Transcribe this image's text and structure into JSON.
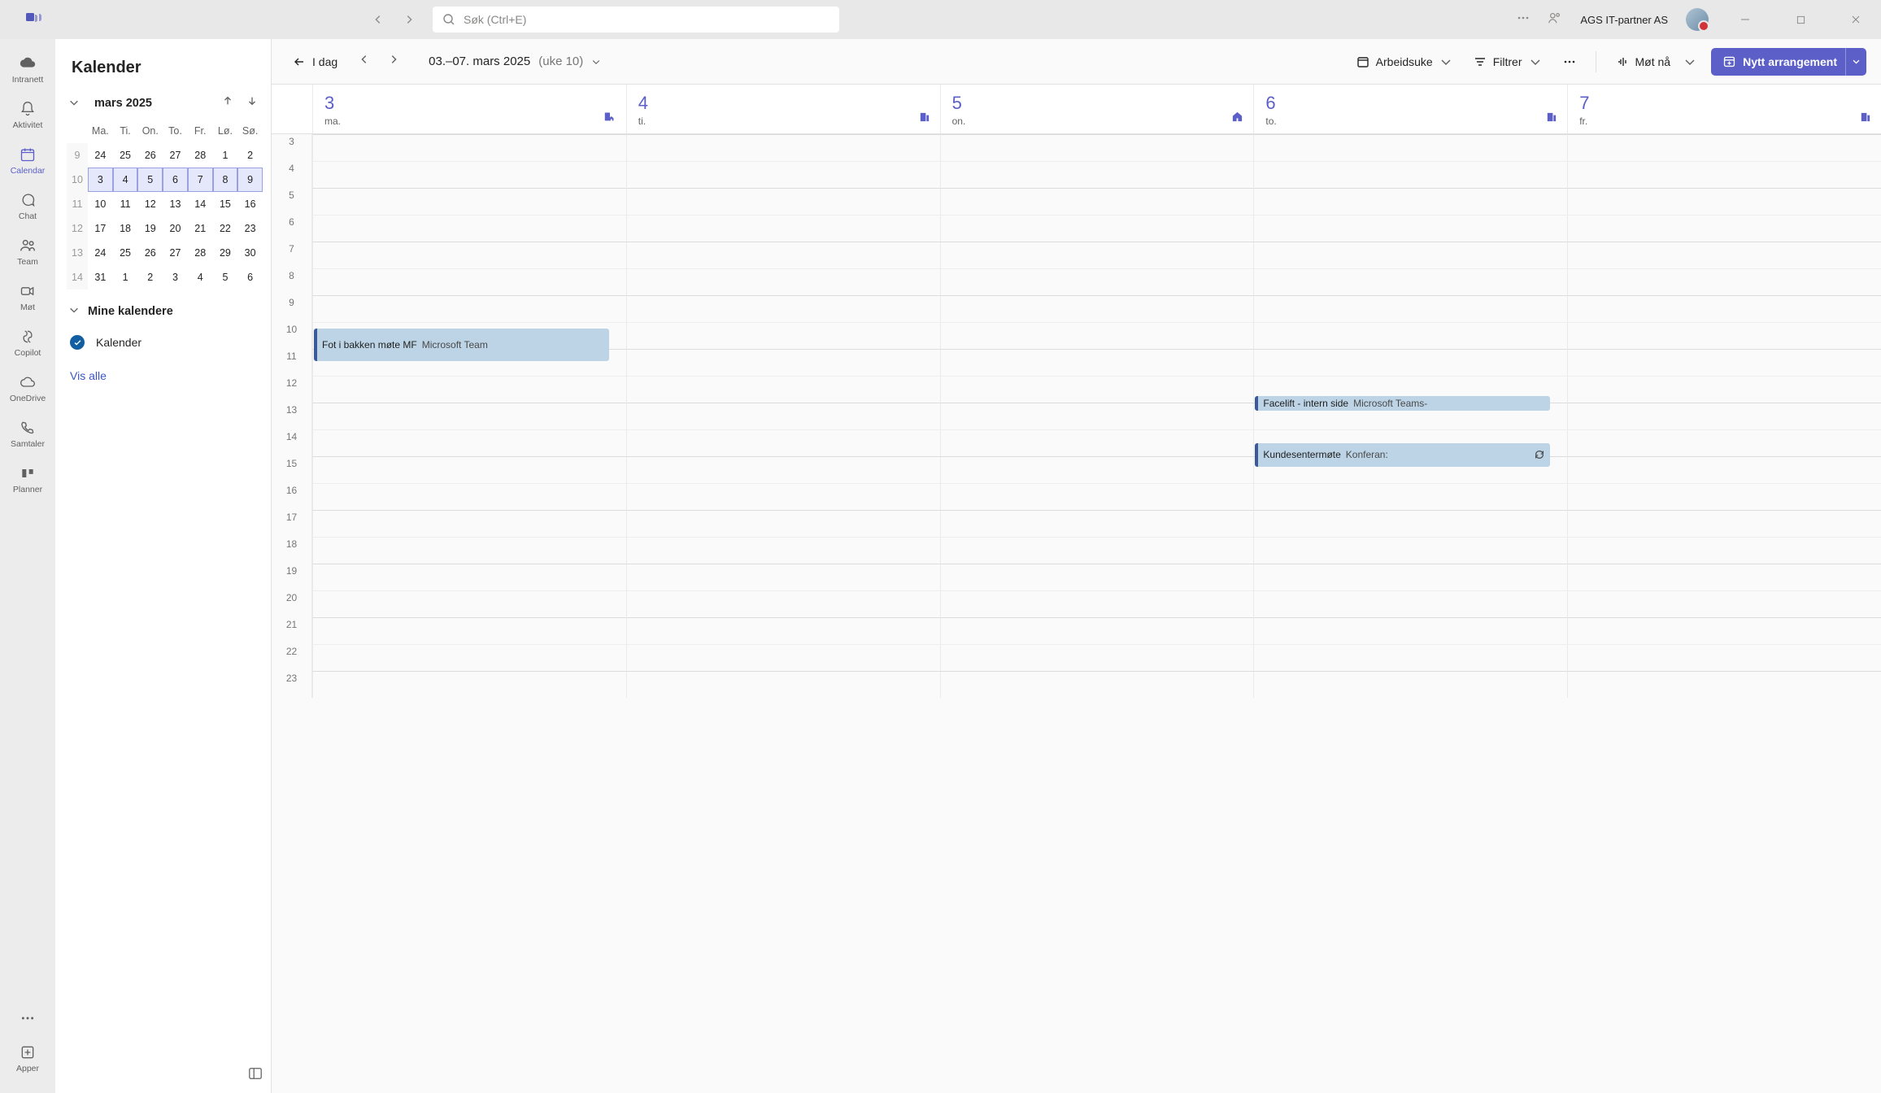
{
  "titlebar": {
    "search_placeholder": "Søk (Ctrl+E)",
    "org": "AGS IT-partner AS"
  },
  "rail": [
    {
      "id": "intranett",
      "label": "Intranett"
    },
    {
      "id": "aktivitet",
      "label": "Aktivitet"
    },
    {
      "id": "calendar",
      "label": "Calendar"
    },
    {
      "id": "chat",
      "label": "Chat"
    },
    {
      "id": "team",
      "label": "Team"
    },
    {
      "id": "mot",
      "label": "Møt"
    },
    {
      "id": "copilot",
      "label": "Copilot"
    },
    {
      "id": "onedrive",
      "label": "OneDrive"
    },
    {
      "id": "samtaler",
      "label": "Samtaler"
    },
    {
      "id": "planner",
      "label": "Planner"
    }
  ],
  "rail_apps": "Apper",
  "sidebar": {
    "title": "Kalender",
    "minical": {
      "month_label": "mars 2025",
      "dow": [
        "Ma.",
        "Ti.",
        "On.",
        "To.",
        "Fr.",
        "Lø.",
        "Sø."
      ],
      "weeks": [
        {
          "wn": "9",
          "days": [
            "24",
            "25",
            "26",
            "27",
            "28",
            "1",
            "2"
          ],
          "selected": false
        },
        {
          "wn": "10",
          "days": [
            "3",
            "4",
            "5",
            "6",
            "7",
            "8",
            "9"
          ],
          "selected": true
        },
        {
          "wn": "11",
          "days": [
            "10",
            "11",
            "12",
            "13",
            "14",
            "15",
            "16"
          ],
          "selected": false
        },
        {
          "wn": "12",
          "days": [
            "17",
            "18",
            "19",
            "20",
            "21",
            "22",
            "23"
          ],
          "selected": false
        },
        {
          "wn": "13",
          "days": [
            "24",
            "25",
            "26",
            "27",
            "28",
            "29",
            "30"
          ],
          "selected": false
        },
        {
          "wn": "14",
          "days": [
            "31",
            "1",
            "2",
            "3",
            "4",
            "5",
            "6"
          ],
          "selected": false
        }
      ]
    },
    "my_calendars_label": "Mine kalendere",
    "calendar_item": "Kalender",
    "show_all": "Vis alle"
  },
  "toolbar": {
    "today": "I dag",
    "range_main": "03.–07. mars 2025",
    "range_week": "(uke 10)",
    "view": "Arbeidsuke",
    "filter": "Filtrer",
    "meet_now": "Møt nå",
    "new_event": "Nytt arrangement"
  },
  "grid": {
    "days": [
      {
        "num": "3",
        "dow": "ma.",
        "loc_icon": "building-home"
      },
      {
        "num": "4",
        "dow": "ti.",
        "loc_icon": "building"
      },
      {
        "num": "5",
        "dow": "on.",
        "loc_icon": "home"
      },
      {
        "num": "6",
        "dow": "to.",
        "loc_icon": "building"
      },
      {
        "num": "7",
        "dow": "fr.",
        "loc_icon": "building"
      }
    ],
    "hours": [
      "3",
      "4",
      "5",
      "6",
      "7",
      "8",
      "9",
      "10",
      "11",
      "12",
      "13",
      "14",
      "15",
      "16",
      "17",
      "18",
      "19",
      "20",
      "21",
      "22",
      "23"
    ],
    "events": [
      {
        "title": "Fot i bakken møte MF",
        "location": "Microsoft Team",
        "day": 0,
        "start_hour": 10.25,
        "end_hour": 11.5,
        "narrow": true,
        "recurring": false
      },
      {
        "title": "Facelift - intern side",
        "location": "Microsoft Teams-",
        "day": 3,
        "start_hour": 12.75,
        "end_hour": 13.25,
        "narrow": false,
        "recurring": false
      },
      {
        "title": "Kundesentermøte",
        "location": "Konferan:",
        "day": 3,
        "start_hour": 14.5,
        "end_hour": 15.45,
        "narrow": false,
        "recurring": true
      }
    ]
  }
}
